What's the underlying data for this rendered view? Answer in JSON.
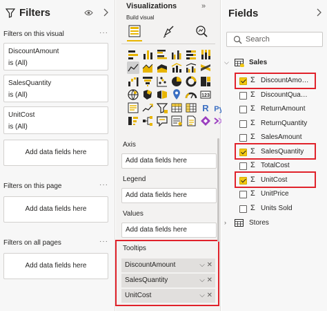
{
  "filters": {
    "title": "Filters",
    "on_this_visual": "Filters on this visual",
    "more": "···",
    "cards": [
      {
        "name": "DiscountAmount",
        "value": "is (All)"
      },
      {
        "name": "SalesQuantity",
        "value": "is (All)"
      },
      {
        "name": "UnitCost",
        "value": "is (All)"
      }
    ],
    "add_fields": "Add data fields here",
    "on_this_page": "Filters on this page",
    "on_all_pages": "Filters on all pages"
  },
  "viz": {
    "title": "Visualizations",
    "collapse": "»",
    "build_visual": "Build visual",
    "icons": [
      "stacked-bar-chart",
      "stacked-column-chart",
      "clustered-bar-chart",
      "clustered-column-chart",
      "100-stacked-bar-chart",
      "100-stacked-column-chart",
      "line-chart",
      "area-chart",
      "stacked-area-chart",
      "line-and-column-chart",
      "line-and-clustered-column-chart",
      "ribbon-chart",
      "waterfall-chart",
      "funnel-chart",
      "scatter-chart",
      "pie-chart",
      "donut-chart",
      "treemap",
      "map",
      "filled-map",
      "shape-map",
      "azure-map",
      "gauge",
      "card",
      "multi-row-card",
      "kpi",
      "slicer",
      "table",
      "matrix",
      "r-script-visual",
      "python-visual",
      "key-influencers",
      "decomposition-tree",
      "qa-visual",
      "smart-narrative",
      "paginated-report",
      "power-apps",
      "more-visuals"
    ],
    "r_label": "R",
    "py_label": "Py",
    "wells": {
      "axis": "Axis",
      "legend": "Legend",
      "values": "Values",
      "tooltips": "Tooltips",
      "add_fields": "Add data fields here",
      "tooltip_items": [
        "DiscountAmount",
        "SalesQuantity",
        "UnitCost"
      ],
      "item_controls": "⌵ ✕"
    }
  },
  "fields": {
    "title": "Fields",
    "search_placeholder": "Search",
    "tables": [
      {
        "name": "Sales",
        "expanded": true,
        "fields": [
          {
            "name": "DiscountAmount",
            "display": "DiscountAmo…",
            "checked": true
          },
          {
            "name": "DiscountQuantity",
            "display": "DiscountQua…",
            "checked": false
          },
          {
            "name": "ReturnAmount",
            "display": "ReturnAmount",
            "checked": false
          },
          {
            "name": "ReturnQuantity",
            "display": "ReturnQuantity",
            "checked": false
          },
          {
            "name": "SalesAmount",
            "display": "SalesAmount",
            "checked": false
          },
          {
            "name": "SalesQuantity",
            "display": "SalesQuantity",
            "checked": true
          },
          {
            "name": "TotalCost",
            "display": "TotalCost",
            "checked": false
          },
          {
            "name": "UnitCost",
            "display": "UnitCost",
            "checked": true
          },
          {
            "name": "UnitPrice",
            "display": "UnitPrice",
            "checked": false
          },
          {
            "name": "Units Sold",
            "display": "Units Sold",
            "checked": false
          }
        ]
      },
      {
        "name": "Stores",
        "expanded": false
      }
    ],
    "sigma": "Σ",
    "expanded_caret": "⌵",
    "collapsed_caret": "›"
  },
  "colors": {
    "highlight": "#e0212a",
    "accent": "#f2c811",
    "tab_underline": "#e8b500"
  }
}
